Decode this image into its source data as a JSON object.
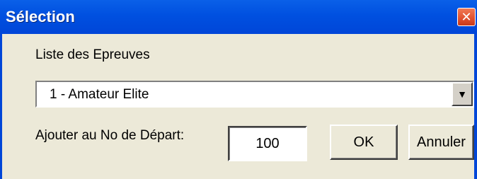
{
  "window": {
    "title": "Sélection",
    "close_symbol": "✕"
  },
  "dialog": {
    "list_label": "Liste des Epreuves",
    "selected_event": "1  - Amateur Elite",
    "dropdown_arrow": "▼",
    "start_number_label": "Ajouter au No de Départ:",
    "start_number_value": "100",
    "ok_label": "OK",
    "cancel_label": "Annuler"
  },
  "colors": {
    "titlebar": "#0050E0",
    "face": "#ECE9D8",
    "close": "#E0502E"
  }
}
